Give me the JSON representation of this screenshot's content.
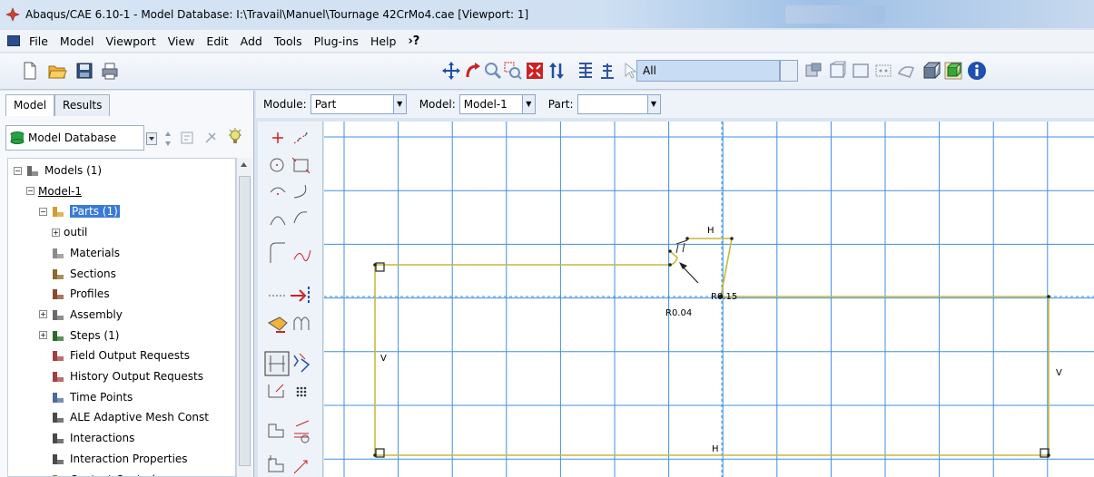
{
  "window": {
    "title": "Abaqus/CAE 6.10-1 - Model Database: I:\\Travail\\Manuel\\Tournage 42CrMo4.cae [Viewport: 1]"
  },
  "menu": {
    "items": [
      "File",
      "Model",
      "Viewport",
      "View",
      "Edit",
      "Add",
      "Tools",
      "Plug-ins",
      "Help"
    ],
    "whats_this": "›?"
  },
  "selection_filter": {
    "value": "All"
  },
  "tabs": {
    "model": "Model",
    "results": "Results"
  },
  "model_db_select": {
    "value": "Model Database"
  },
  "tree": [
    {
      "label": "Models (1)",
      "icon": "models-icon",
      "indent": 0,
      "expander": "-"
    },
    {
      "label": "Model-1",
      "icon": "",
      "indent": 1,
      "expander": "-"
    },
    {
      "label": "Parts (1)",
      "icon": "parts-icon",
      "indent": 2,
      "expander": "-",
      "selected": true
    },
    {
      "label": "outil",
      "icon": "",
      "indent": 3,
      "expander": "+"
    },
    {
      "label": "Materials",
      "icon": "materials-icon",
      "indent": 2,
      "expander": ""
    },
    {
      "label": "Sections",
      "icon": "sections-icon",
      "indent": 2,
      "expander": ""
    },
    {
      "label": "Profiles",
      "icon": "profiles-icon",
      "indent": 2,
      "expander": ""
    },
    {
      "label": "Assembly",
      "icon": "assembly-icon",
      "indent": 2,
      "expander": "+"
    },
    {
      "label": "Steps (1)",
      "icon": "steps-icon",
      "indent": 2,
      "expander": "+"
    },
    {
      "label": "Field Output Requests",
      "icon": "field-output-icon",
      "indent": 2,
      "expander": ""
    },
    {
      "label": "History Output Requests",
      "icon": "history-output-icon",
      "indent": 2,
      "expander": ""
    },
    {
      "label": "Time Points",
      "icon": "time-points-icon",
      "indent": 2,
      "expander": ""
    },
    {
      "label": "ALE Adaptive Mesh Const",
      "icon": "ale-mesh-icon",
      "indent": 2,
      "expander": ""
    },
    {
      "label": "Interactions",
      "icon": "interactions-icon",
      "indent": 2,
      "expander": ""
    },
    {
      "label": "Interaction Properties",
      "icon": "interaction-properties-icon",
      "indent": 2,
      "expander": ""
    },
    {
      "label": "Contact Controls",
      "icon": "contact-controls-icon",
      "indent": 2,
      "expander": ""
    }
  ],
  "module_bar": {
    "module_label": "Module:",
    "module_value": "Part",
    "model_label": "Model:",
    "model_value": "Model-1",
    "part_label": "Part:",
    "part_value": ""
  },
  "sketch": {
    "dims": {
      "h_top": "H",
      "h_bottom": "H",
      "v_left": "V",
      "v_right": "V",
      "r_small": "R0.04",
      "r_large": "R0.15"
    }
  },
  "colors": {
    "grid": "#3f8fe0",
    "sketch": "#c8b93c",
    "selection": "#3a7bd5",
    "title_text": "#000000"
  }
}
